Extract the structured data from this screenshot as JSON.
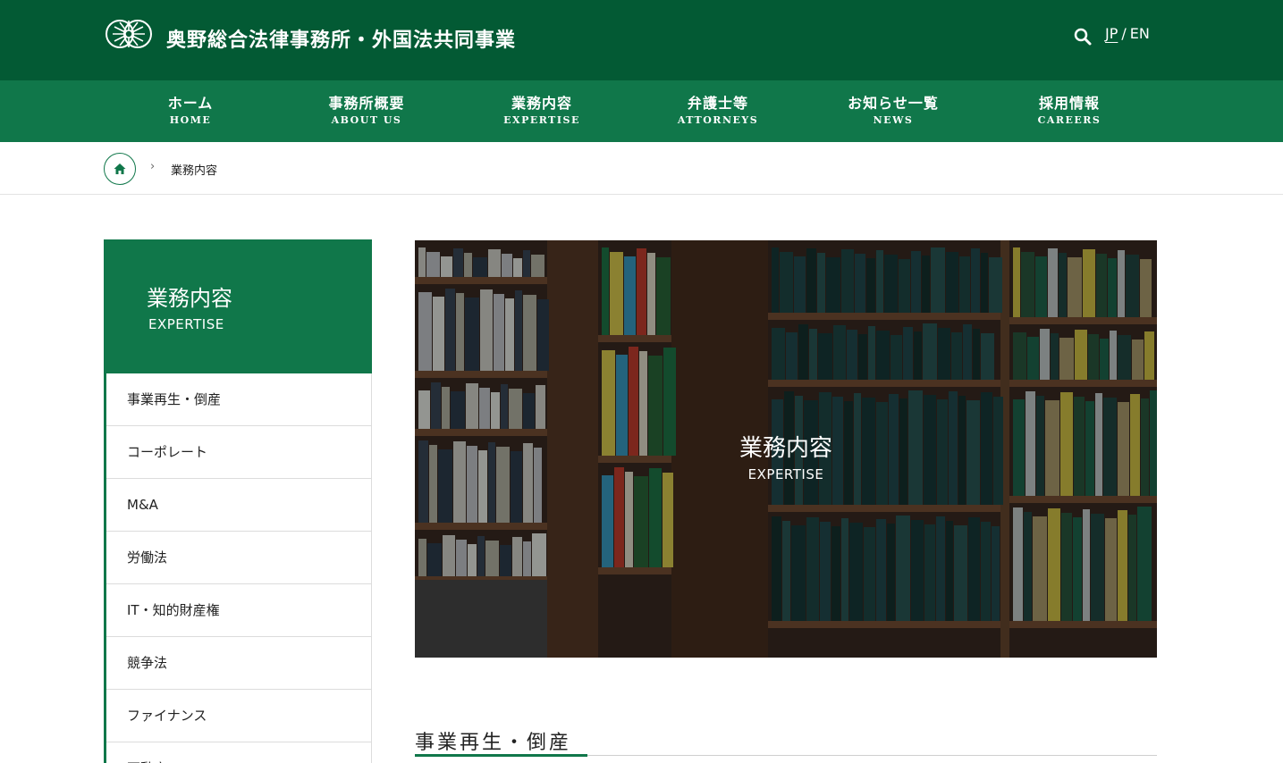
{
  "header": {
    "site_title": "奥野総合法律事務所・外国法共同事業",
    "lang_jp": "JP",
    "lang_sep": "/",
    "lang_en": "EN",
    "brand_color": "#035a34",
    "logo_icon": "chrysanthemum-logo-icon",
    "search_icon": "search-icon"
  },
  "nav": {
    "color": "#10774a",
    "items": [
      {
        "jp": "ホーム",
        "en": "HOME"
      },
      {
        "jp": "事務所概要",
        "en": "ABOUT US"
      },
      {
        "jp": "業務内容",
        "en": "EXPERTISE"
      },
      {
        "jp": "弁護士等",
        "en": "ATTORNEYS"
      },
      {
        "jp": "お知らせ一覧",
        "en": "NEWS"
      },
      {
        "jp": "採用情報",
        "en": "CAREERS"
      }
    ]
  },
  "breadcrumb": {
    "home_icon": "home-icon",
    "separator": "›",
    "current": "業務内容"
  },
  "sidebar": {
    "title_jp": "業務内容",
    "title_en": "EXPERTISE",
    "items": [
      "事業再生・倒産",
      "コーポレート",
      "M&A",
      "労働法",
      "IT・知的財産権",
      "競争法",
      "ファイナンス",
      "不動産"
    ]
  },
  "hero": {
    "title_jp": "業務内容",
    "title_en": "EXPERTISE"
  },
  "section": {
    "title": "事業再生・倒産"
  }
}
